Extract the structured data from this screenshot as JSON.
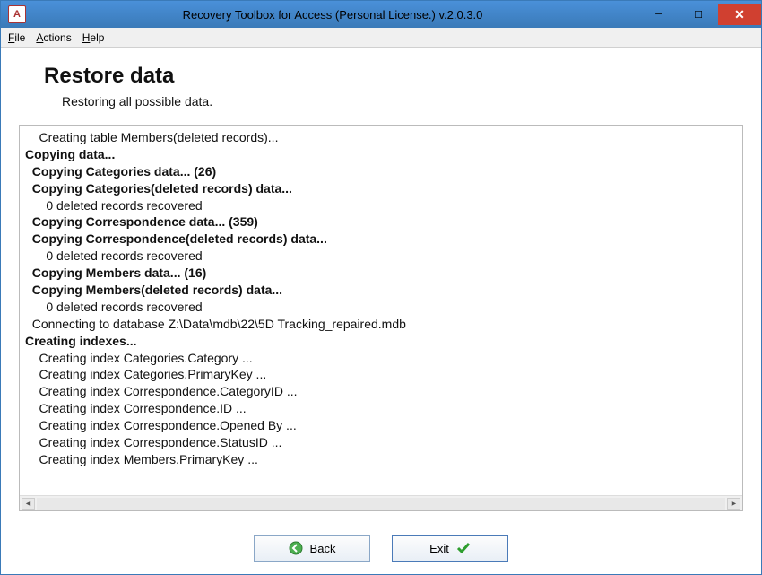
{
  "window": {
    "title": "Recovery Toolbox for Access (Personal License.) v.2.0.3.0",
    "app_icon_label": "A"
  },
  "menubar": {
    "file": "File",
    "actions": "Actions",
    "help": "Help"
  },
  "page": {
    "title": "Restore data",
    "subtitle": "Restoring all possible data."
  },
  "log": [
    {
      "text": "    Creating table Members(deleted records)...",
      "bold": false
    },
    {
      "text": "Copying data...",
      "bold": true
    },
    {
      "text": "  Copying Categories data... (26)",
      "bold": true
    },
    {
      "text": "  Copying Categories(deleted records) data...",
      "bold": true
    },
    {
      "text": "      0 deleted records recovered",
      "bold": false
    },
    {
      "text": "  Copying Correspondence data... (359)",
      "bold": true
    },
    {
      "text": "  Copying Correspondence(deleted records) data...",
      "bold": true
    },
    {
      "text": "      0 deleted records recovered",
      "bold": false
    },
    {
      "text": "  Copying Members data... (16)",
      "bold": true
    },
    {
      "text": "  Copying Members(deleted records) data...",
      "bold": true
    },
    {
      "text": "      0 deleted records recovered",
      "bold": false
    },
    {
      "text": "  Connecting to database Z:\\Data\\mdb\\22\\5D Tracking_repaired.mdb",
      "bold": false
    },
    {
      "text": "Creating indexes...",
      "bold": true
    },
    {
      "text": "    Creating index Categories.Category ...",
      "bold": false
    },
    {
      "text": "    Creating index Categories.PrimaryKey ...",
      "bold": false
    },
    {
      "text": "    Creating index Correspondence.CategoryID ...",
      "bold": false
    },
    {
      "text": "    Creating index Correspondence.ID ...",
      "bold": false
    },
    {
      "text": "    Creating index Correspondence.Opened By ...",
      "bold": false
    },
    {
      "text": "    Creating index Correspondence.StatusID ...",
      "bold": false
    },
    {
      "text": "    Creating index Members.PrimaryKey ...",
      "bold": false
    }
  ],
  "buttons": {
    "back": "Back",
    "exit": "Exit"
  }
}
